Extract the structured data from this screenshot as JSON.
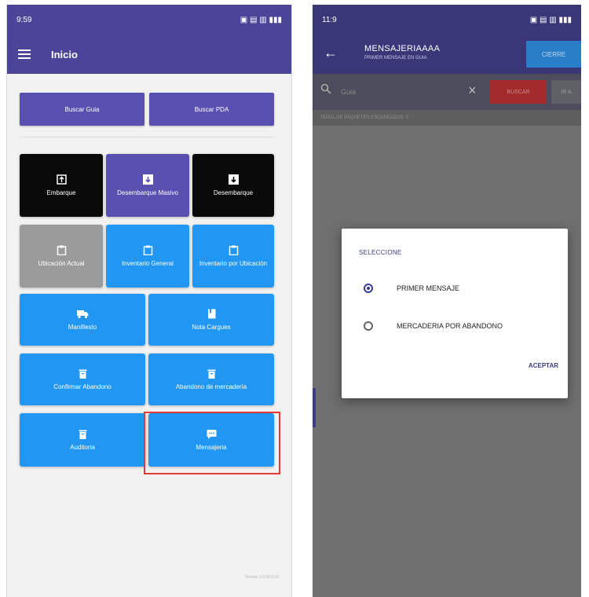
{
  "left": {
    "status_time": "9:59",
    "status_right": "▣ ▤ ▥ ▮▮▮",
    "appbar_title": "Inicio",
    "search_buttons": [
      "Buscar Guia",
      "Buscar PDA"
    ],
    "tiles": {
      "embarque": "Embarque",
      "desembarque_masivo": "Desembarque Masivo",
      "desembarque": "Desembarque",
      "ubicacion_actual": "Ubicación Actual",
      "inventario_general": "Inventario General",
      "inventario_ubicacion": "Inventario por Ubicación",
      "manifiesto": "Manifiesto",
      "nota_cargue": "Nota Cargues",
      "confirmar_abandono": "Confirmar Abandono",
      "abandono_mercaderia": "Abandono de mercadería",
      "auditoria": "Auditoria",
      "mensajeria": "Mensajeria"
    },
    "footer_version": "Version 1.0.00.0.00"
  },
  "right": {
    "status_time": "11:9",
    "status_right": "▣ ▤ ▥ ▮▮▮",
    "title": "MENSAJERIAAAA",
    "subtitle": "PRIMER MENSAJE EN GUIA",
    "cierre_label": "CIERRE",
    "search_placeholder": "Guia",
    "buscar_label": "BUSCAR",
    "ira_label": "IR A",
    "total_text": "TOTAL DE PAQUETES ESCANEADOS: 0",
    "dialog": {
      "title": "SELECCIONE",
      "options": [
        "PRIMER MENSAJE",
        "MERCADERIA POR ABANDONO"
      ],
      "selected": 0,
      "accept": "ACEPTAR"
    }
  },
  "colors": {
    "primary": "#4b4498",
    "tile_blue": "#2196f3",
    "tile_black": "#0a0a0a",
    "tile_gray": "#9b9b9b",
    "highlight_red": "#e53935"
  }
}
